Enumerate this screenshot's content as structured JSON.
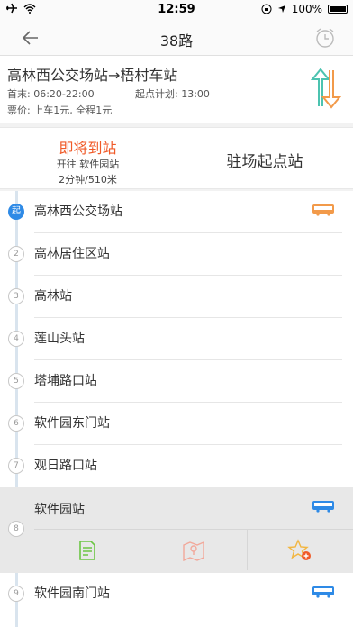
{
  "status": {
    "time": "12:59",
    "battery": "100%"
  },
  "nav": {
    "title": "38路"
  },
  "route": {
    "name": "高林西公交场站→梧村车站",
    "first_last": "首末: 06:20-22:00",
    "plan": "起点计划: 13:00",
    "price": "票价: 上车1元, 全程1元"
  },
  "arrival": {
    "arriving": "即将到站",
    "next": "开往 软件园站",
    "eta": "2分钟/510米",
    "parked": "驻场起点站"
  },
  "stops": [
    {
      "num": "起",
      "name": "高林西公交场站"
    },
    {
      "num": "2",
      "name": "高林居住区站"
    },
    {
      "num": "3",
      "name": "高林站"
    },
    {
      "num": "4",
      "name": "莲山头站"
    },
    {
      "num": "5",
      "name": "塔埔路口站"
    },
    {
      "num": "6",
      "name": "软件园东门站"
    },
    {
      "num": "7",
      "name": "观日路口站"
    },
    {
      "num": "8",
      "name": "软件园站"
    },
    {
      "num": "9",
      "name": "软件园南门站"
    }
  ],
  "colors": {
    "accent_orange": "#f05a28",
    "blue": "#2e8ae6",
    "green": "#6cc644"
  }
}
